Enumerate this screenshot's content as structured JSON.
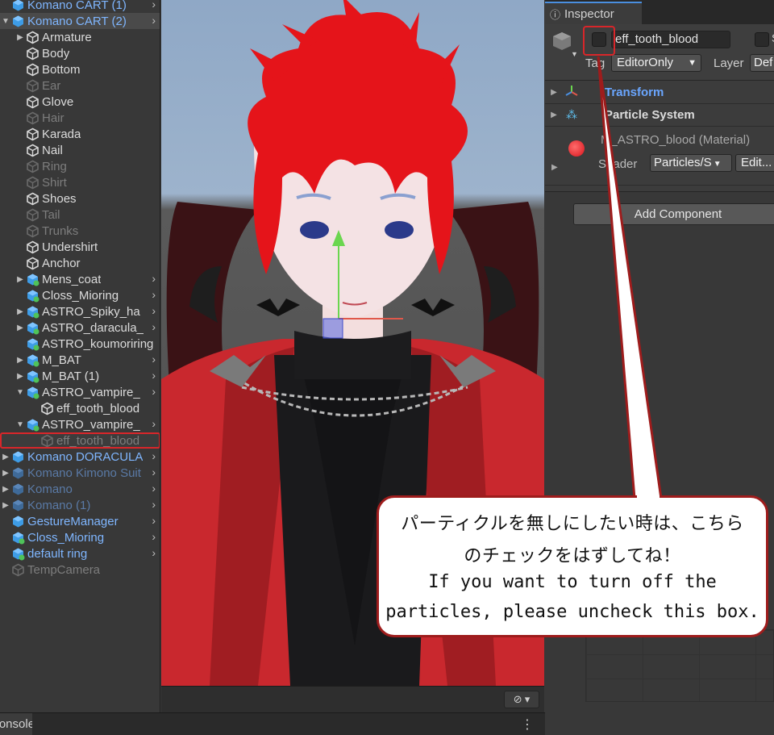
{
  "hierarchy": {
    "items": [
      {
        "label": "Komano CART (1)",
        "indent": 0,
        "fold": "",
        "style": "blue",
        "arrow": true
      },
      {
        "label": "Komano CART (2)",
        "indent": 0,
        "fold": "▼",
        "style": "blue",
        "arrow": true,
        "top": true
      },
      {
        "label": "Armature",
        "indent": 1,
        "fold": "▶",
        "style": "normal",
        "arrow": false
      },
      {
        "label": "Body",
        "indent": 1,
        "fold": "",
        "style": "normal",
        "arrow": false
      },
      {
        "label": "Bottom",
        "indent": 1,
        "fold": "",
        "style": "normal",
        "arrow": false
      },
      {
        "label": "Ear",
        "indent": 1,
        "fold": "",
        "style": "dim",
        "arrow": false
      },
      {
        "label": "Glove",
        "indent": 1,
        "fold": "",
        "style": "normal",
        "arrow": false
      },
      {
        "label": "Hair",
        "indent": 1,
        "fold": "",
        "style": "dim",
        "arrow": false
      },
      {
        "label": "Karada",
        "indent": 1,
        "fold": "",
        "style": "normal",
        "arrow": false
      },
      {
        "label": "Nail",
        "indent": 1,
        "fold": "",
        "style": "normal",
        "arrow": false
      },
      {
        "label": "Ring",
        "indent": 1,
        "fold": "",
        "style": "dim",
        "arrow": false
      },
      {
        "label": "Shirt",
        "indent": 1,
        "fold": "",
        "style": "dim",
        "arrow": false
      },
      {
        "label": "Shoes",
        "indent": 1,
        "fold": "",
        "style": "normal",
        "arrow": false
      },
      {
        "label": "Tail",
        "indent": 1,
        "fold": "",
        "style": "dim",
        "arrow": false
      },
      {
        "label": "Trunks",
        "indent": 1,
        "fold": "",
        "style": "dim",
        "arrow": false
      },
      {
        "label": "Undershirt",
        "indent": 1,
        "fold": "",
        "style": "normal",
        "arrow": false
      },
      {
        "label": "Anchor",
        "indent": 1,
        "fold": "",
        "style": "normal",
        "arrow": false
      },
      {
        "label": "Mens_coat",
        "indent": 1,
        "fold": "▶",
        "style": "normal",
        "arrow": true,
        "prefab": true
      },
      {
        "label": "Closs_Mioring",
        "indent": 1,
        "fold": "",
        "style": "normal",
        "arrow": true,
        "prefab": true
      },
      {
        "label": "ASTRO_Spiky_ha",
        "indent": 1,
        "fold": "▶",
        "style": "normal",
        "arrow": true,
        "prefab": true
      },
      {
        "label": "ASTRO_daracula_",
        "indent": 1,
        "fold": "▶",
        "style": "normal",
        "arrow": true,
        "prefab": true
      },
      {
        "label": "ASTRO_koumoriring",
        "indent": 1,
        "fold": "",
        "style": "normal",
        "arrow": false,
        "prefab": true
      },
      {
        "label": "M_BAT",
        "indent": 1,
        "fold": "▶",
        "style": "normal",
        "arrow": true,
        "prefab": true
      },
      {
        "label": "M_BAT (1)",
        "indent": 1,
        "fold": "▶",
        "style": "normal",
        "arrow": true,
        "prefab": true
      },
      {
        "label": "ASTRO_vampire_",
        "indent": 1,
        "fold": "▼",
        "style": "normal",
        "arrow": true,
        "prefab": true
      },
      {
        "label": "eff_tooth_blood",
        "indent": 2,
        "fold": "",
        "style": "normal",
        "arrow": false
      },
      {
        "label": "ASTRO_vampire_",
        "indent": 1,
        "fold": "▼",
        "style": "normal",
        "arrow": true,
        "prefab": true
      },
      {
        "label": "eff_tooth_blood",
        "indent": 2,
        "fold": "",
        "style": "dim",
        "arrow": false,
        "selected": true
      },
      {
        "label": "Komano DORACULA",
        "indent": 0,
        "fold": "▶",
        "style": "blue",
        "arrow": true
      },
      {
        "label": "Komano Kimono Suit",
        "indent": 0,
        "fold": "▶",
        "style": "dimblue",
        "arrow": true
      },
      {
        "label": "Komano",
        "indent": 0,
        "fold": "▶",
        "style": "dimblue",
        "arrow": true
      },
      {
        "label": "Komano (1)",
        "indent": 0,
        "fold": "▶",
        "style": "dimblue",
        "arrow": true
      },
      {
        "label": "GestureManager",
        "indent": 0,
        "fold": "",
        "style": "blue",
        "arrow": true
      },
      {
        "label": "Closs_Mioring",
        "indent": 0,
        "fold": "",
        "style": "blue",
        "arrow": true,
        "prefab": true
      },
      {
        "label": "default ring",
        "indent": 0,
        "fold": "",
        "style": "blue",
        "arrow": true,
        "prefab": true
      },
      {
        "label": "TempCamera",
        "indent": 0,
        "fold": "",
        "style": "dim",
        "arrow": false
      }
    ]
  },
  "scene": {
    "gizmo_label": "▾"
  },
  "inspector": {
    "tab_label": "Inspector",
    "object_name": "eff_tooth_blood",
    "static_label": "S",
    "tag_label": "Tag",
    "tag_value": "EditorOnly",
    "layer_label": "Layer",
    "layer_value": "Def",
    "components": [
      {
        "label": "Transform",
        "icon": "transform-icon"
      },
      {
        "label": "Particle System",
        "icon": "particle-system-icon"
      }
    ],
    "material_name": "M_ASTRO_blood (Material)",
    "shader_label": "Shader",
    "shader_value": "Particles/S",
    "edit_label": "Edit...",
    "add_component_label": "Add Component"
  },
  "console": {
    "tab_label": "Console"
  },
  "callout": {
    "line1": "パーティクルを無しにしたい時は、こちら",
    "line2": "のチェックをはずしてね！",
    "line3": "If you want to turn off the",
    "line4": "particles, please uncheck this box."
  },
  "colors": {
    "highlight_red": "#d8262a",
    "callout_border": "#9e1c1c",
    "hierarchy_blue": "#7fb6ff",
    "hair_red": "#e5141a"
  }
}
